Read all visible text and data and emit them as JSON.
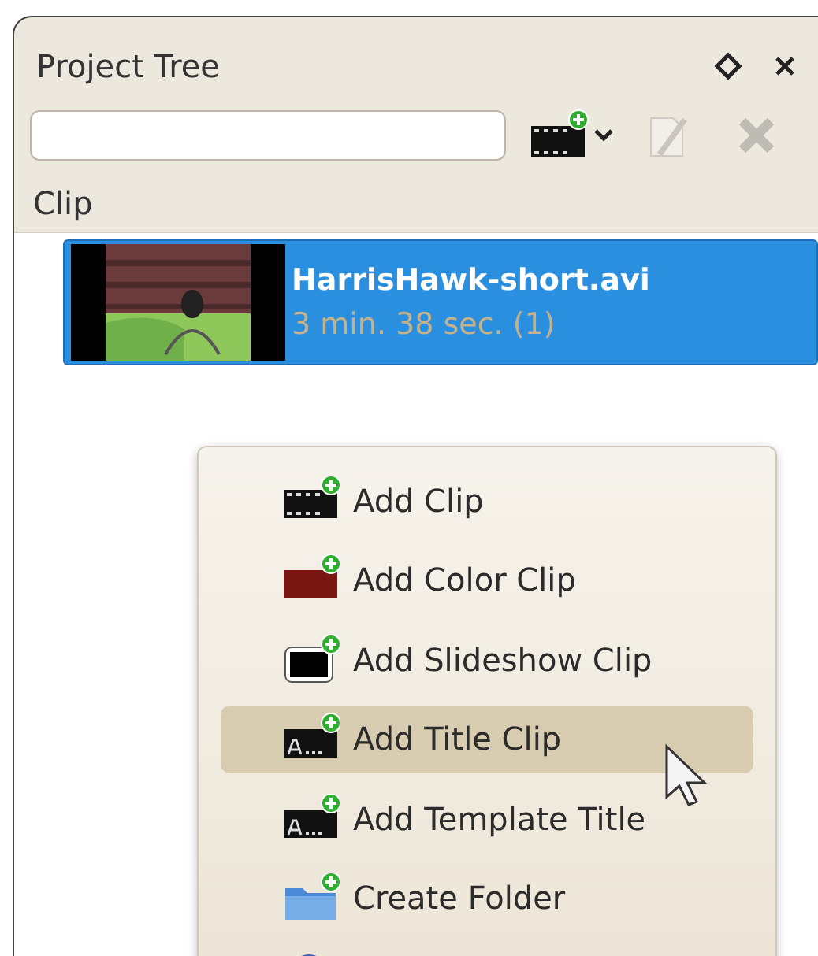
{
  "panel": {
    "title": "Project Tree"
  },
  "toolbar": [
    {
      "kind": "add",
      "disabled": false
    },
    {
      "kind": "edit",
      "disabled": true
    },
    {
      "kind": "delete",
      "disabled": true
    }
  ],
  "column_header": "Clip",
  "clips": [
    {
      "name": "HarrisHawk-short.avi",
      "duration": "3 min. 38 sec. (1)",
      "selected": true,
      "kind": "picture"
    }
  ],
  "context_menu": [
    {
      "kind": "film",
      "label": "Add Clip",
      "selected": false
    },
    {
      "kind": "color",
      "label": "Add Color Clip",
      "selected": false
    },
    {
      "kind": "slideshow",
      "label": "Add Slideshow Clip",
      "selected": false
    },
    {
      "kind": "title",
      "label": "Add Title Clip",
      "selected": true
    },
    {
      "kind": "title",
      "label": "Add Template Title",
      "selected": false
    },
    {
      "kind": "folder",
      "label": "Create Folder",
      "selected": false
    },
    {
      "kind": "circle",
      "selected": false
    }
  ]
}
